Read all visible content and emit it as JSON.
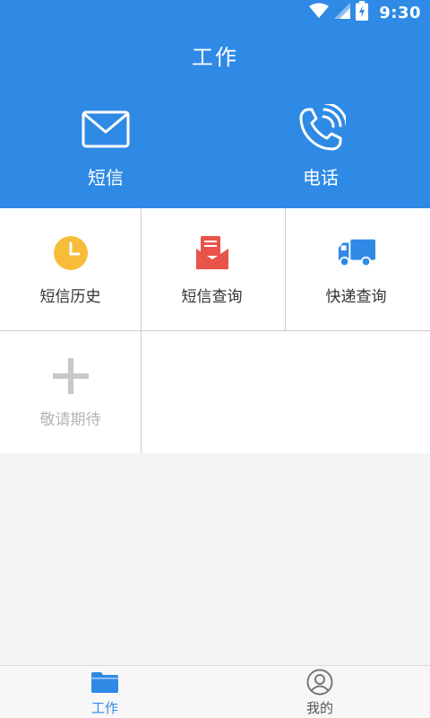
{
  "status_bar": {
    "time": "9:30",
    "icons": [
      "wifi-icon",
      "signal-icon",
      "battery-charging-icon"
    ]
  },
  "header": {
    "title": "工作",
    "actions": [
      {
        "label": "短信",
        "icon": "envelope-icon"
      },
      {
        "label": "电话",
        "icon": "phone-ringing-icon"
      }
    ]
  },
  "grid": {
    "items": [
      {
        "label": "短信历史",
        "icon": "clock-icon",
        "color": "#f7bd3a"
      },
      {
        "label": "短信查询",
        "icon": "mail-open-icon",
        "color": "#e9544a"
      },
      {
        "label": "快递查询",
        "icon": "truck-icon",
        "color": "#2f8ae5"
      },
      {
        "label": "敬请期待",
        "icon": "plus-icon",
        "color": "#c8c8c8"
      }
    ]
  },
  "bottom_nav": {
    "items": [
      {
        "label": "工作",
        "icon": "folder-icon",
        "active": true
      },
      {
        "label": "我的",
        "icon": "user-icon",
        "active": false
      }
    ]
  },
  "colors": {
    "primary": "#2f8ae5",
    "background": "#f3f4f4"
  }
}
